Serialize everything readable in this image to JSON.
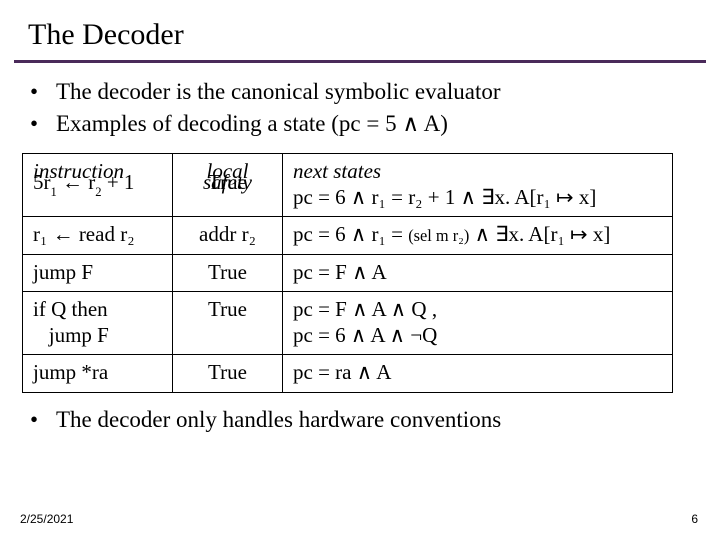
{
  "title": "The Decoder",
  "bullets_top": [
    "The decoder is the canonical symbolic evaluator",
    "Examples of decoding a state (pc = 5 ∧ A)"
  ],
  "table": {
    "headers": {
      "c1a": "instruction",
      "c1b_prefix": "5",
      "c1b_main": "r",
      "c1b_sub1": "1",
      "c1b_arrow": " ← r",
      "c1b_sub2": "2",
      "c1b_tail": " + 1",
      "c2a": "local",
      "c2b_over": "safety",
      "c2b_under": "True",
      "c3a": "next states",
      "c3b": "pc = 6  ∧  r₁ = r₂ + 1  ∧  ∃x. A[r₁ ↦ x]"
    },
    "rows": [
      {
        "c1": "r₁ ← read r₂",
        "c2": "addr r₂",
        "c3_pre": "pc = 6 ∧ r₁ = ",
        "c3_sel": "(sel m r₂)",
        "c3_post": " ∧ ∃x. A[r₁ ↦ x]"
      },
      {
        "c1": "jump F",
        "c2": "True",
        "c3": "pc = F  ∧  A"
      },
      {
        "c1": "if Q then\n   jump F",
        "c2": "True",
        "c3": "pc = F  ∧  A  ∧  Q ,\npc = 6  ∧  A  ∧  ¬Q"
      },
      {
        "c1": "jump *ra",
        "c2": "True",
        "c3": "pc = ra  ∧  A"
      }
    ]
  },
  "bullets_bottom": [
    "The decoder only handles hardware conventions"
  ],
  "footer_date": "2/25/2021",
  "page_number": "6"
}
